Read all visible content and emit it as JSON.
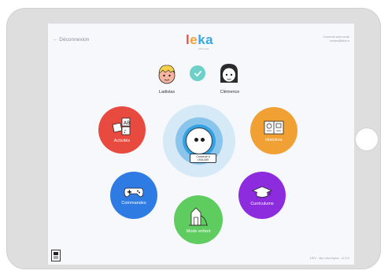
{
  "header": {
    "back_label": "← Déconnexion",
    "logo_letters": [
      "l",
      "e",
      "k",
      "a"
    ],
    "logo_colors": [
      "#e8534a",
      "#f3a13a",
      "#3aa7e0",
      "#3aa7e0"
    ],
    "logo_subtitle": "APF Leka",
    "connection_line1": "Connecté avec email",
    "connection_line2": "ssssss@leka.io"
  },
  "users": {
    "left_name": "Ladislas",
    "right_name": "Clémence"
  },
  "robot": {
    "status_line1": "Connecté à",
    "status_line2": "LKAL069"
  },
  "menu": {
    "activities": {
      "label": "Activités",
      "color": "#e94a3f"
    },
    "stories": {
      "label": "Histoires",
      "color": "#f1a034"
    },
    "commands": {
      "label": "Commandes",
      "color": "#2e7be3"
    },
    "curriculums": {
      "label": "Curriculums",
      "color": "#8d2bdf"
    },
    "child_mode": {
      "label": "Mode enfant",
      "color": "#5fcc5f"
    }
  },
  "footer": {
    "version": "DEV - 4fp Leka Alpha - v2.0.0"
  }
}
